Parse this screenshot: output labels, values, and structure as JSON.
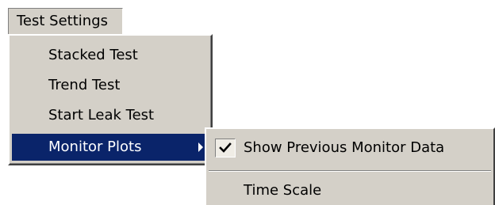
{
  "menubar": {
    "title": "Test Settings"
  },
  "dropdown": {
    "items": [
      {
        "label": "Stacked Test"
      },
      {
        "label": "Trend Test"
      },
      {
        "label": "Start Leak Test"
      },
      {
        "label": "Monitor Plots",
        "highlighted": true,
        "has_submenu": true
      }
    ]
  },
  "submenu": {
    "items": [
      {
        "label": "Show Previous Monitor Data",
        "checked": true
      },
      {
        "label": "Time Scale"
      }
    ]
  },
  "colors": {
    "menu_face": "#d4d0c8",
    "highlight": "#0a246a",
    "highlight_text": "#ffffff"
  },
  "icons": {
    "submenu_arrow": "triangle-right-icon",
    "checkmark": "checkmark-icon"
  }
}
